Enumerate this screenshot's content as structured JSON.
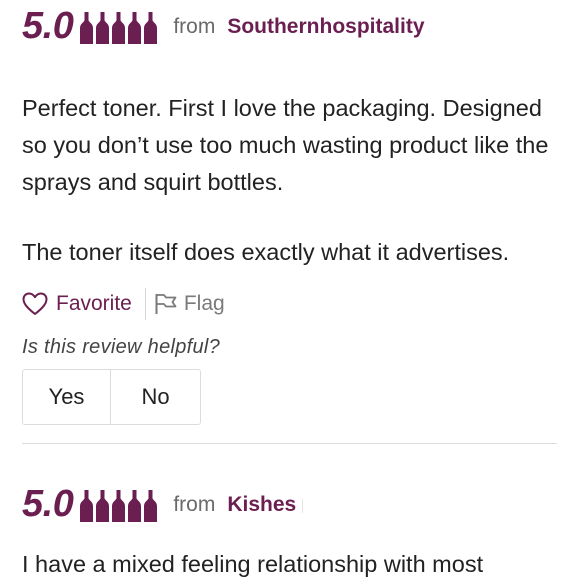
{
  "colors": {
    "accent": "#6b1f50",
    "text": "#222222",
    "muted": "#6a6a6a"
  },
  "reviews": [
    {
      "score": "5.0",
      "bottle_icon": "wine-bottle-icon",
      "bottle_rating": 5,
      "from_label": "from",
      "author": "Southernhospitality",
      "paragraphs": [
        "Perfect toner. First I love the packaging. Designed so you don’t use too much wasting product like the sprays and squirt bottles.",
        "The toner itself does exactly what it advertises."
      ],
      "favorite_label": "Favorite",
      "flag_label": "Flag",
      "helpful_question": "Is this review helpful?",
      "yes_label": "Yes",
      "no_label": "No"
    },
    {
      "score": "5.0",
      "bottle_icon": "wine-bottle-icon",
      "bottle_rating": 5,
      "from_label": "from",
      "author": "Kishes",
      "paragraphs": [
        "I have a mixed feeling relationship with most"
      ]
    }
  ]
}
